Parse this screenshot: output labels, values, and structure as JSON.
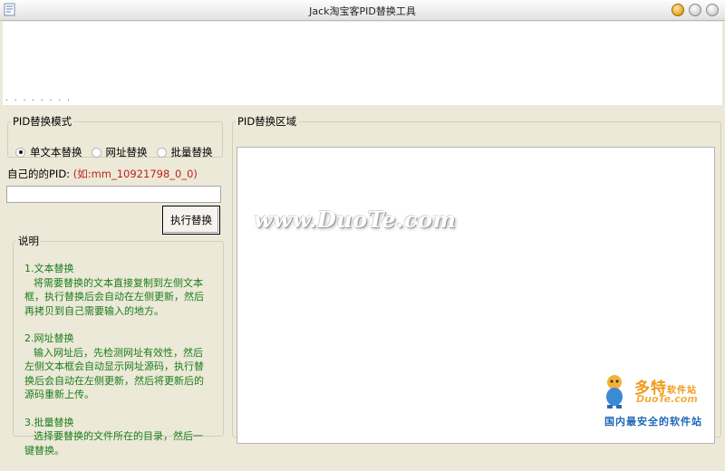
{
  "window": {
    "title": "Jack淘宝客PID替换工具"
  },
  "top_area": {
    "dots": ". . . . . . . ."
  },
  "mode_group": {
    "legend": "PID替换模式",
    "options": [
      {
        "label": "单文本替换",
        "selected": true
      },
      {
        "label": "网址替换",
        "selected": false
      },
      {
        "label": "批量替换",
        "selected": false
      }
    ]
  },
  "pid": {
    "label": "自己的的PID:",
    "example": "(如:mm_10921798_0_0)",
    "value": ""
  },
  "execute_button": {
    "label": "执行替换"
  },
  "notes": {
    "legend": "说明",
    "sections": [
      {
        "heading": "1.文本替换",
        "body": "将需要替换的文本直接复制到左侧文本框，执行替换后会自动在左侧更新，然后再拷贝到自己需要输入的地方。"
      },
      {
        "heading": "2.网址替换",
        "body": "输入网址后，先检测网址有效性，然后左侧文本框会自动显示网址源码，执行替换后会自动在左侧更新，然后将更新后的源码重新上传。"
      },
      {
        "heading": "3.批量替换",
        "body": "选择要替换的文件所在的目录，然后一键替换。"
      }
    ]
  },
  "replace_area": {
    "legend": "PID替换区域",
    "value": ""
  },
  "watermark": {
    "text": "www.DuoTe.com"
  },
  "logo": {
    "brand": "多特",
    "suffix": "软件站",
    "url": "DuoTe.com",
    "slogan": "国内最安全的软件站"
  },
  "colors": {
    "window_bg": "#ece9d8",
    "notes_text": "#1a7d1a",
    "example_text": "#c02020"
  }
}
